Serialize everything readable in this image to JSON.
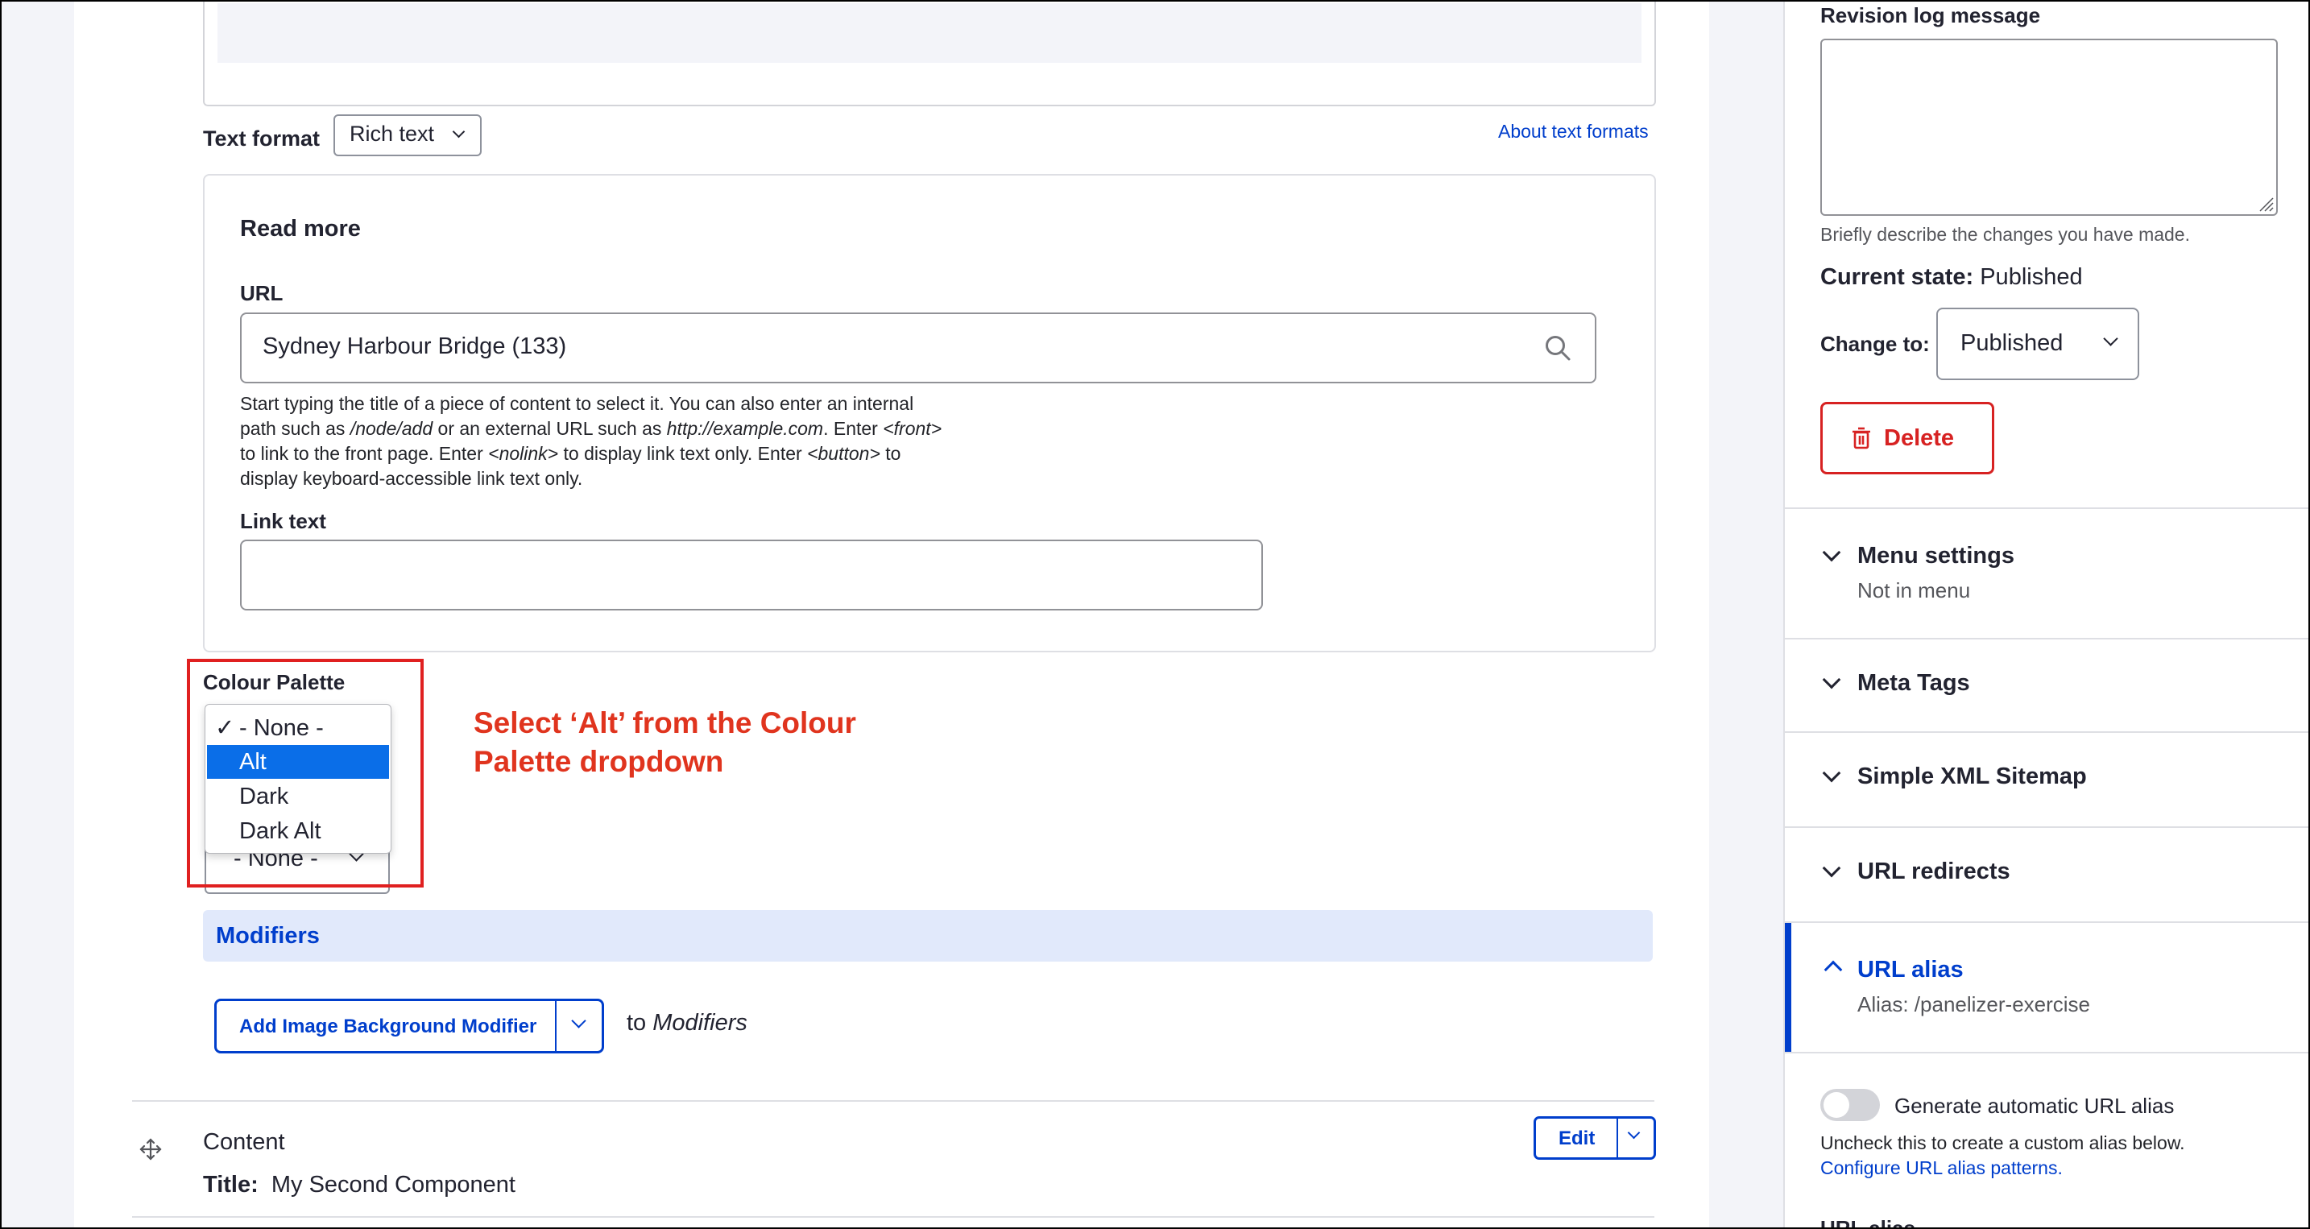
{
  "editor": {
    "text_format_label": "Text format",
    "text_format_value": "Rich text",
    "about_text_formats": "About text formats"
  },
  "read_more": {
    "title": "Read more",
    "url_label": "URL",
    "url_value": "Sydney Harbour Bridge (133)",
    "url_help": {
      "l1a": "Start typing the title of a piece of content to select it. You can also enter an internal",
      "l2a": "path such as ",
      "l2b": "/node/add",
      "l2c": " or an external URL such as ",
      "l2d": "http://example.com",
      "l2e": ". Enter ",
      "l2f": "<front>",
      "l3a": "to link to the front page. Enter ",
      "l3b": "<nolink>",
      "l3c": " to display link text only. Enter ",
      "l3d": "<button>",
      "l3e": " to",
      "l4a": "display keyboard-accessible link text only."
    },
    "link_text_label": "Link text",
    "link_text_value": ""
  },
  "colour_palette": {
    "label": "Colour Palette",
    "checkmark": "✓",
    "options": [
      "- None -",
      "Alt",
      "Dark",
      "Dark Alt"
    ],
    "selected_index": 0,
    "highlighted_index": 1,
    "second_select_value": "- None -"
  },
  "annotation": {
    "line1": "Select ‘Alt’ from the Colour",
    "line2": "Palette dropdown",
    "color": "#e0341e"
  },
  "modifiers": {
    "title": "Modifiers",
    "add_button": "Add Image Background Modifier",
    "to": "to",
    "target": "Modifiers"
  },
  "component": {
    "name": "Content",
    "title_label": "Title:",
    "title_value": "My Second Component",
    "edit_button": "Edit"
  },
  "sidebar": {
    "revision_label": "Revision log message",
    "revision_value": "",
    "revision_help": "Briefly describe the changes you have made.",
    "current_state_label": "Current state:",
    "current_state_value": "Published",
    "change_to_label": "Change to:",
    "change_to_value": "Published",
    "delete_button": "Delete",
    "menu_settings": "Menu settings",
    "menu_settings_sub": "Not in menu",
    "meta_tags": "Meta Tags",
    "sitemap": "Simple XML Sitemap",
    "url_redirects": "URL redirects",
    "url_alias": "URL alias",
    "url_alias_sub": "Alias: /panelizer-exercise",
    "generate_alias_label": "Generate automatic URL alias",
    "generate_alias_help": "Uncheck this to create a custom alias below.",
    "configure_link": "Configure URL alias patterns.",
    "url_alias_field_label": "URL alias"
  },
  "colors": {
    "accent": "#003ecc",
    "danger": "#d72222",
    "highlight": "#0a6ee8",
    "modifiers_bg": "#e1e9fb"
  }
}
